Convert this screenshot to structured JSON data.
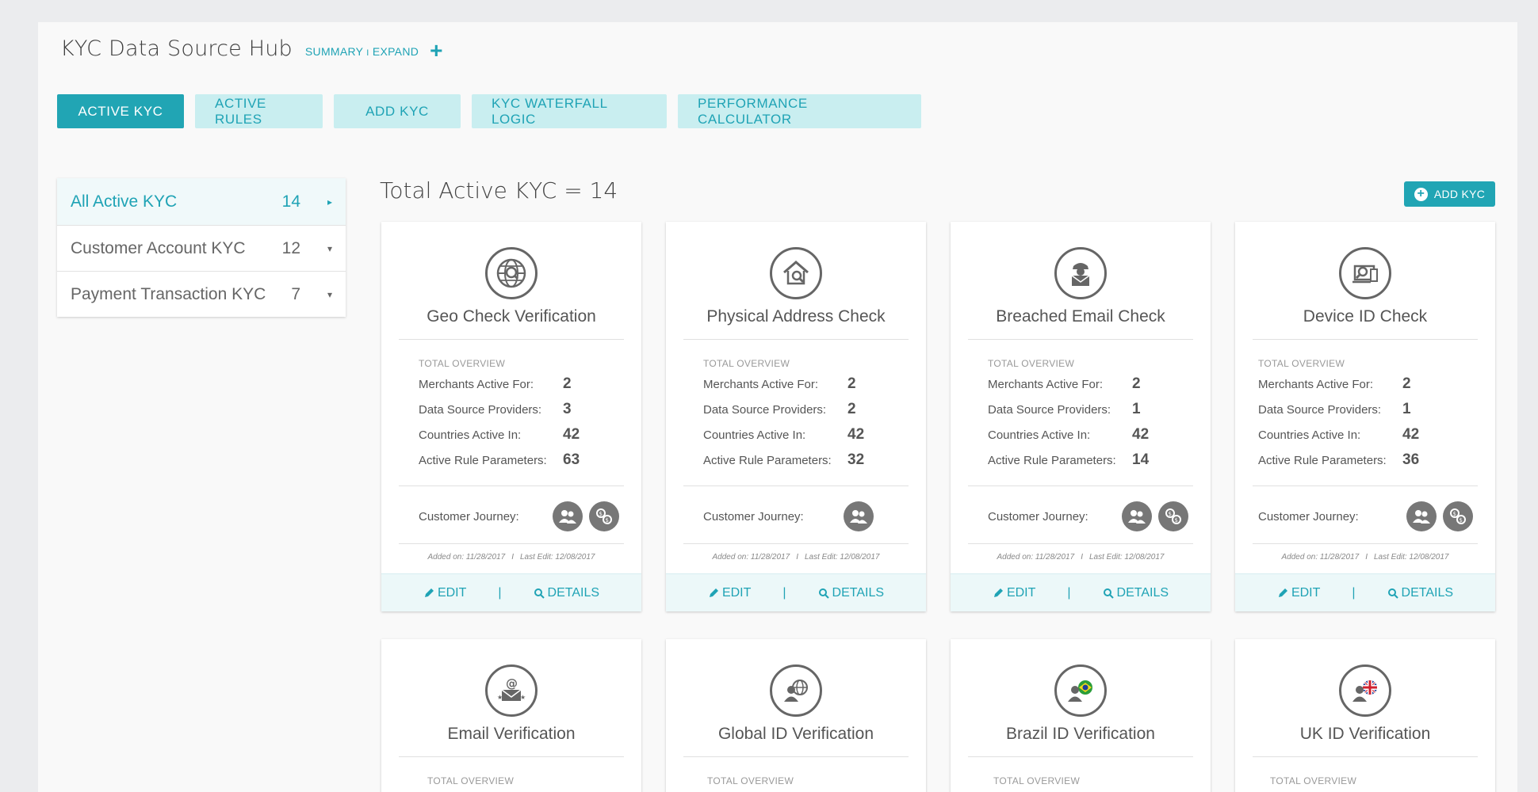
{
  "app": {
    "title": "KYC Data Source Hub",
    "summary_label": "SUMMARY",
    "separator": "I",
    "expand_label": "EXPAND",
    "add_icon": "plus-icon"
  },
  "tabs": [
    {
      "label": "ACTIVE KYC",
      "active": true
    },
    {
      "label": "ACTIVE RULES",
      "active": false
    },
    {
      "label": "ADD KYC",
      "active": false
    },
    {
      "label": "KYC WATERFALL LOGIC",
      "active": false
    },
    {
      "label": "PERFORMANCE CALCULATOR",
      "active": false
    }
  ],
  "sidebar": {
    "items": [
      {
        "label": "All Active KYC",
        "count": "14",
        "arrow": "▸"
      },
      {
        "label": "Customer Account KYC",
        "count": "12",
        "arrow": "▾"
      },
      {
        "label": "Payment Transaction KYC",
        "count": "7",
        "arrow": "▾"
      }
    ]
  },
  "main": {
    "title": "Total Active KYC = 14",
    "add_button_label": "ADD KYC",
    "add_button_icon": "+"
  },
  "labels": {
    "overview": "TOTAL OVERVIEW",
    "merchants": "Merchants Active For:",
    "providers": "Data Source Providers:",
    "countries": "Countries Active In:",
    "rules": "Active Rule Parameters:",
    "journey": "Customer Journey:",
    "edit": "EDIT",
    "details": "DETAILS",
    "pipe": "|",
    "date_sep": "I"
  },
  "cards": [
    {
      "title": "Geo Check Verification",
      "icon": "globe-search-icon",
      "merchants": "2",
      "providers": "3",
      "countries": "42",
      "rules": "63",
      "journey_icons": [
        "account-journey-icon",
        "payment-journey-icon"
      ],
      "added": "Added on: 11/28/2017",
      "edited": "Last Edit: 12/08/2017"
    },
    {
      "title": "Physical Address Check",
      "icon": "house-search-icon",
      "merchants": "2",
      "providers": "2",
      "countries": "42",
      "rules": "32",
      "journey_icons": [
        "account-journey-icon"
      ],
      "added": "Added on: 11/28/2017",
      "edited": "Last Edit: 12/08/2017"
    },
    {
      "title": "Breached Email Check",
      "icon": "spy-envelope-icon",
      "merchants": "2",
      "providers": "1",
      "countries": "42",
      "rules": "14",
      "journey_icons": [
        "account-journey-icon",
        "payment-journey-icon"
      ],
      "added": "Added on: 11/28/2017",
      "edited": "Last Edit: 12/08/2017"
    },
    {
      "title": "Device ID Check",
      "icon": "device-search-icon",
      "merchants": "2",
      "providers": "1",
      "countries": "42",
      "rules": "36",
      "journey_icons": [
        "account-journey-icon",
        "payment-journey-icon"
      ],
      "added": "Added on: 11/28/2017",
      "edited": "Last Edit: 12/08/2017"
    }
  ],
  "cards_row2": [
    {
      "title": "Email Verification",
      "icon": "email-at-icon",
      "overview": "TOTAL OVERVIEW"
    },
    {
      "title": "Global ID Verification",
      "icon": "person-globe-icon",
      "overview": "TOTAL OVERVIEW"
    },
    {
      "title": "Brazil ID Verification",
      "icon": "person-brazil-flag-icon",
      "overview": "TOTAL OVERVIEW"
    },
    {
      "title": "UK ID Verification",
      "icon": "person-uk-flag-icon",
      "overview": "TOTAL OVERVIEW"
    }
  ],
  "colors": {
    "accent": "#21a5b4",
    "tab_inactive_bg": "#c9eef0",
    "icon_gray": "#666666"
  }
}
